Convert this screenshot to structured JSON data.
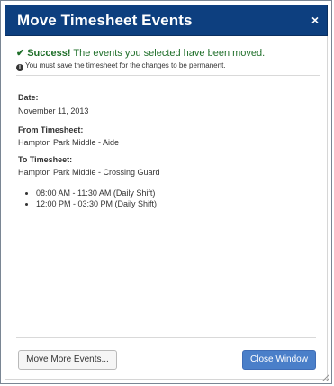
{
  "dialog": {
    "title": "Move Timesheet Events",
    "close_glyph": "×"
  },
  "notice": {
    "check_glyph": "✔",
    "success_strong": "Success!",
    "success_text": " The events you selected have been moved.",
    "info_glyph": "i",
    "info_text": "You must save the timesheet for the changes to be permanent."
  },
  "details": {
    "date_label": "Date:",
    "date_value": "November 11, 2013",
    "from_label": "From Timesheet:",
    "from_value": "Hampton Park Middle - Aide",
    "to_label": "To Timesheet:",
    "to_value": "Hampton Park Middle - Crossing Guard"
  },
  "events": [
    "08:00 AM - 11:30 AM (Daily Shift)",
    "12:00 PM - 03:30 PM (Daily Shift)"
  ],
  "footer": {
    "move_more_label": "Move More Events...",
    "close_window_label": "Close Window"
  },
  "colors": {
    "titlebar": "#0d3f7f",
    "success": "#1f6f2a",
    "primary_button": "#4a7fc9"
  }
}
